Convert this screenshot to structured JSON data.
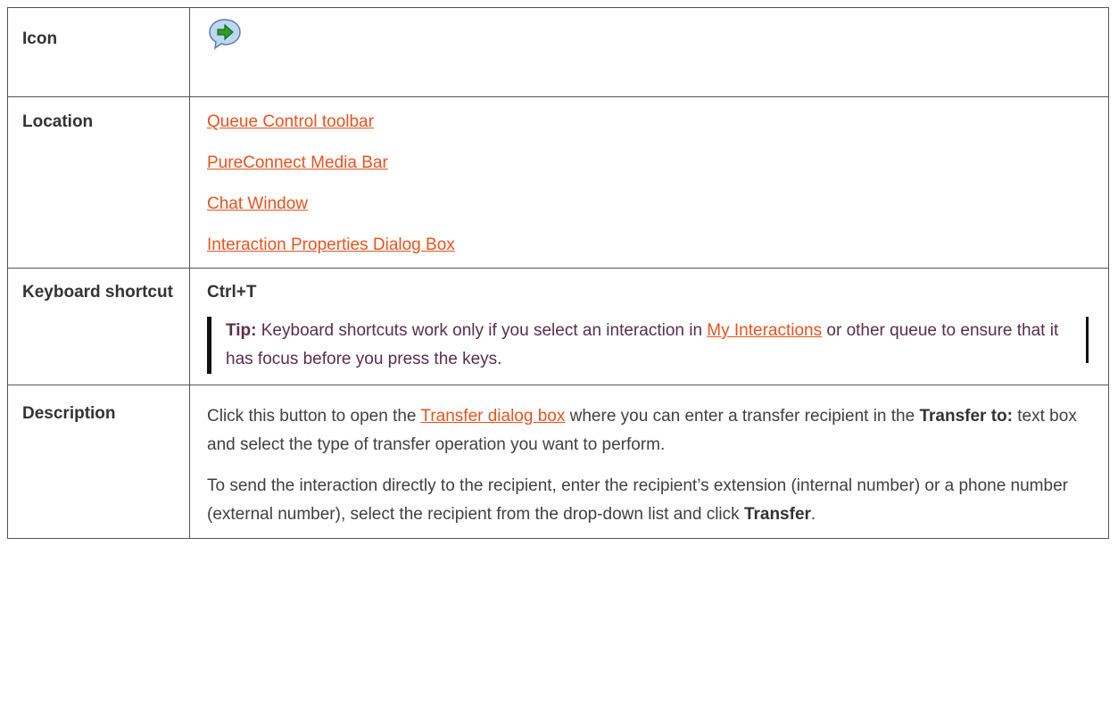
{
  "rows": {
    "icon": {
      "label": "Icon",
      "icon_name": "transfer-arrow-bubble-icon"
    },
    "location": {
      "label": "Location",
      "links": [
        "Queue Control toolbar",
        "PureConnect Media Bar",
        "Chat Window",
        "Interaction Properties Dialog Box"
      ]
    },
    "keyboard": {
      "label": "Keyboard shortcut",
      "shortcut": "Ctrl+T",
      "tip_label": "Tip:",
      "tip_text_1": " Keyboard shortcuts work only if you select an interaction in ",
      "tip_link": "My Interactions",
      "tip_text_2": " or other queue to ensure that it has focus before you press the keys."
    },
    "description": {
      "label": "Description",
      "p1_text_1": "Click this button to open the ",
      "p1_link": "Transfer dialog box",
      "p1_text_2": " where you can enter a transfer recipient in the ",
      "p1_bold": "Transfer to:",
      "p1_text_3": " text box and select the type of transfer operation you want to perform.",
      "p2_text_1": "To send the interaction directly to the recipient, enter the recipient’s extension (internal number) or a phone number (external number), select the recipient from the drop-down list and click ",
      "p2_bold": "Transfer",
      "p2_text_2": "."
    }
  },
  "colors": {
    "link": "#e8531e",
    "tip_text": "#5a2e4a",
    "border": "#555555",
    "icon_arrow": "#2e9b2e",
    "icon_bubble": "#bcd8f0"
  }
}
